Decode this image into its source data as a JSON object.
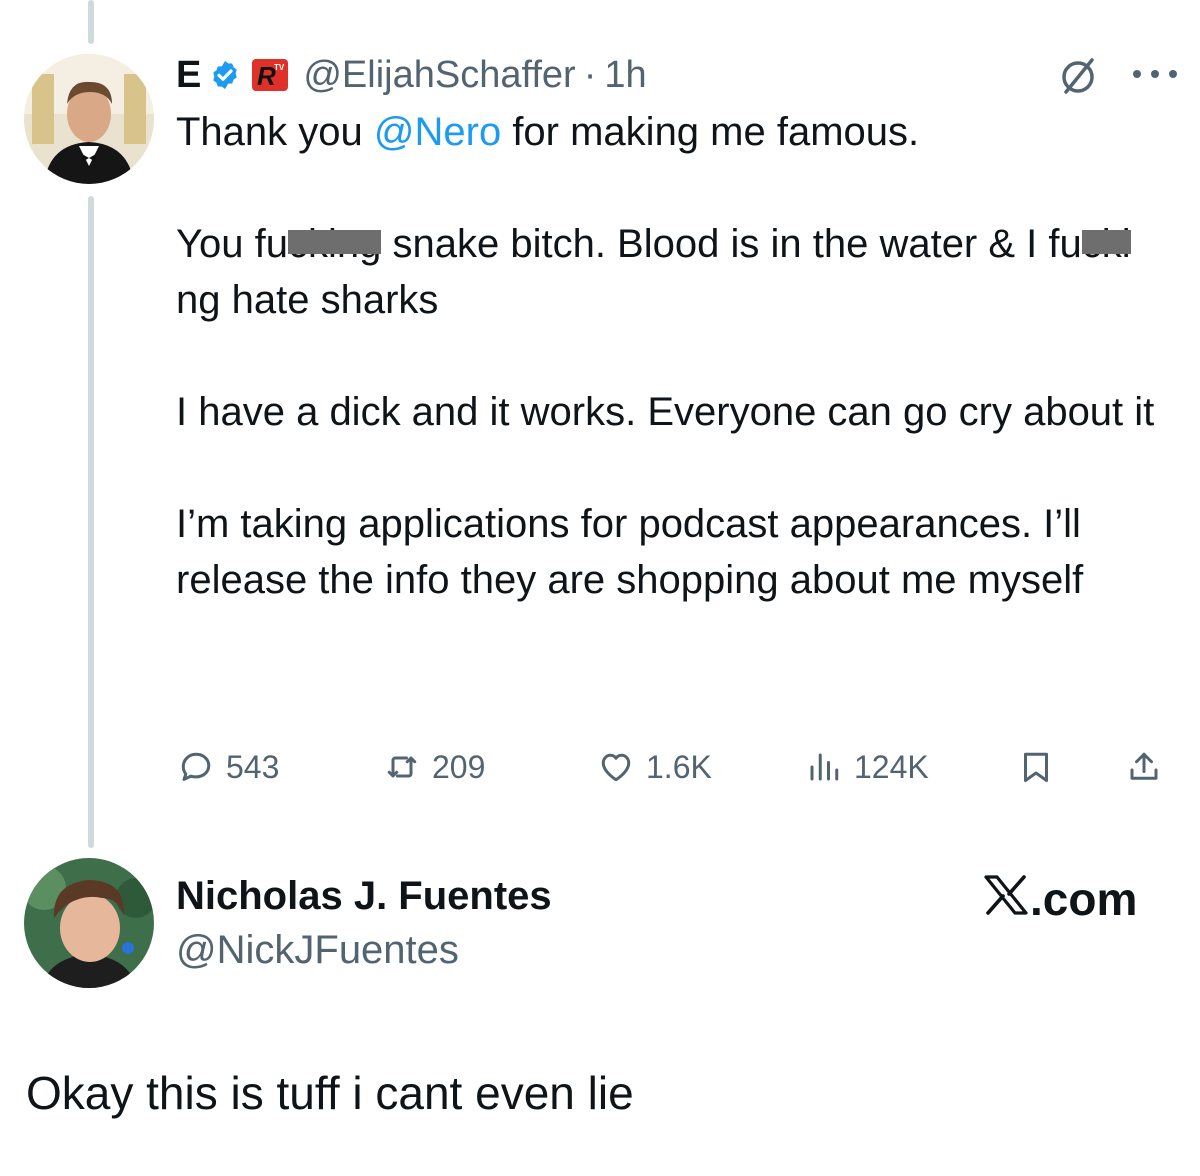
{
  "tweet": {
    "author_name": "E",
    "handle": "@ElijahSchaffer",
    "separator": "·",
    "time": "1h",
    "icons": {
      "verified": "verified-badge-icon",
      "affiliate": "rtv-affiliate-badge-icon",
      "grok": "grok-icon",
      "more": "more-icon"
    },
    "body": {
      "p1_pre": "Thank you ",
      "p1_mention": "@Nero",
      "p1_post": " for making me famous.",
      "p2_a": "You fu",
      "p2_redacted_1": "cking",
      "p2_b": " snake bitch. Blood is in the water & I ",
      "p2_c": "fu",
      "p2_redacted_2": "cki",
      "p2_d": "ng hate sharks",
      "p3": "I have a dick and it works. Everyone can go cry about it",
      "p4": "I’m taking applications for podcast appearances. I’ll release the info they are shopping about me myself"
    },
    "actions": {
      "replies": "543",
      "reposts": "209",
      "likes": "1.6K",
      "views": "124K"
    }
  },
  "quote": {
    "name": "Nicholas J. Fuentes",
    "handle": "@NickJFuentes",
    "brand": ".com",
    "brand_icon": "x-logo-icon",
    "text": "Okay this is tuff i cant even lie"
  },
  "colors": {
    "link": "#1d9bf0",
    "muted": "#536471",
    "thread_line": "#cfd9de",
    "rtv_red": "#e0302a"
  }
}
